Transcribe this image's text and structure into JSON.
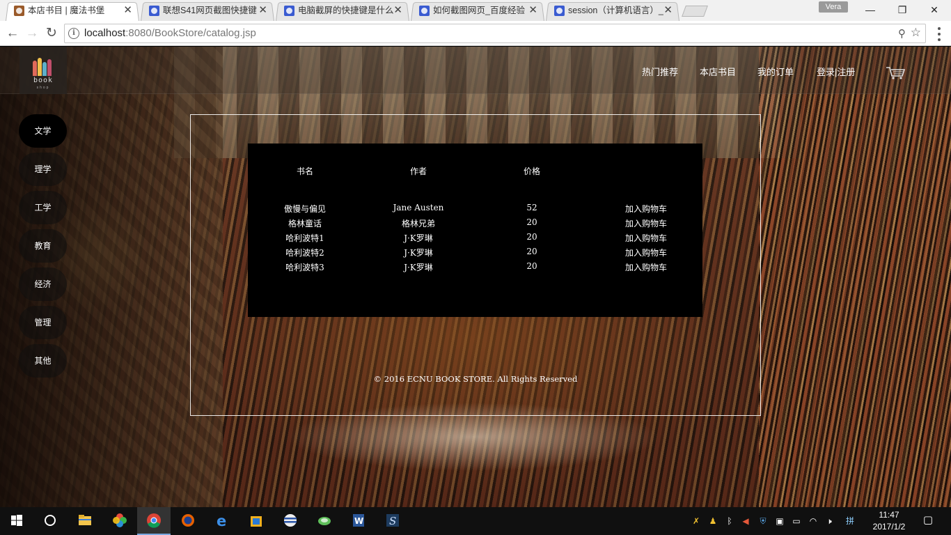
{
  "browser": {
    "tabs": [
      {
        "title": "本店书目 | 魔法书堡",
        "icon": "bookstore-favicon",
        "active": true
      },
      {
        "title": "联想S41网页截图快捷键",
        "icon": "baidu-paw-icon",
        "active": false
      },
      {
        "title": "电脑截屏的快捷键是什么",
        "icon": "baidu-paw-icon",
        "active": false
      },
      {
        "title": "如何截图网页_百度经验",
        "icon": "baidu-paw-icon",
        "active": false
      },
      {
        "title": "session（计算机语言）_",
        "icon": "baidu-paw-icon",
        "active": false
      }
    ],
    "profile_name": "Vera",
    "url_host": "localhost",
    "url_path": ":8080/BookStore/catalog.jsp"
  },
  "site": {
    "logo_text": "book",
    "logo_subtext": "shop",
    "nav": [
      "热门推荐",
      "本店书目",
      "我的订单"
    ],
    "login_label": "登录",
    "separator": "|",
    "register_label": "注册",
    "categories": [
      "文学",
      "理学",
      "工学",
      "教育",
      "经济",
      "管理",
      "其他"
    ],
    "active_category": "文学"
  },
  "catalog": {
    "headers": {
      "title": "书名",
      "author": "作者",
      "price": "价格"
    },
    "rows": [
      {
        "title": "傲慢与偏见",
        "author": "Jane Austen",
        "price": "52",
        "action": "加入购物车"
      },
      {
        "title": "格林童话",
        "author": "格林兄弟",
        "price": "20",
        "action": "加入购物车"
      },
      {
        "title": "哈利波特1",
        "author": "J·K罗琳",
        "price": "20",
        "action": "加入购物车"
      },
      {
        "title": "哈利波特2",
        "author": "J·K罗琳",
        "price": "20",
        "action": "加入购物车"
      },
      {
        "title": "哈利波特3",
        "author": "J·K罗琳",
        "price": "20",
        "action": "加入购物车"
      }
    ],
    "footer": "© 2016 ECNU BOOK STORE. All Rights Reserved"
  },
  "taskbar": {
    "time": "11:47",
    "date": "2017/1/2"
  },
  "colors": {
    "accent": "#79a8e0",
    "table_bg": "#000000",
    "text": "#ffffff"
  }
}
